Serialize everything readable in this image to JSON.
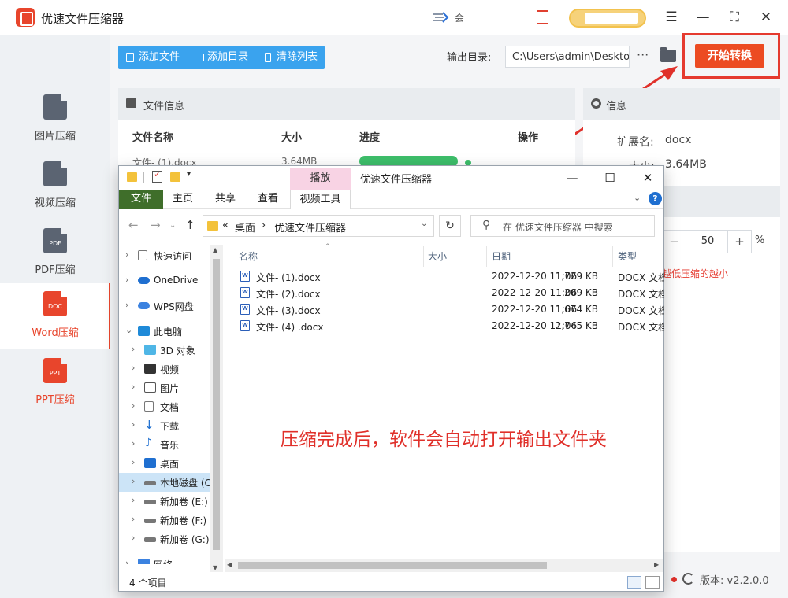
{
  "app": {
    "title": "优速文件压缩器",
    "titlebar_text": "会",
    "window_controls": [
      "☰",
      "—",
      "⛶",
      "✕"
    ]
  },
  "sidebar": {
    "items": [
      {
        "label": "图片压缩",
        "icon": "image-file-icon",
        "badge": ""
      },
      {
        "label": "视频压缩",
        "icon": "video-file-icon",
        "badge": ""
      },
      {
        "label": "PDF压缩",
        "icon": "pdf-file-icon",
        "badge": "PDF"
      },
      {
        "label": "Word压缩",
        "icon": "word-file-icon",
        "badge": "DOC",
        "active": true
      },
      {
        "label": "PPT压缩",
        "icon": "ppt-file-icon",
        "badge": "PPT"
      }
    ]
  },
  "toolbar": {
    "add_file": "添加文件",
    "add_dir": "添加目录",
    "clear_list": "清除列表",
    "output_label": "输出目录:",
    "output_path": "C:\\Users\\admin\\Deskto",
    "more": "···",
    "start": "开始转换"
  },
  "file_panel": {
    "title": "文件信息",
    "columns": [
      "文件名称",
      "大小",
      "进度",
      "操作"
    ],
    "partial_row": {
      "name": "文件- (1).docx",
      "size": "3.64MB",
      "progress": 1.0
    }
  },
  "info_panel": {
    "title": "信息",
    "ext_label": "扩展名:",
    "ext_value": "docx",
    "size_label": "大小:",
    "size_value": "3.64MB",
    "quality_value": "50",
    "quality_unit": "%",
    "hint": "越低压缩的越小"
  },
  "version": "版本: v2.2.0.0",
  "explorer": {
    "context_tab": "播放",
    "title": "优速文件压缩器",
    "ribbon_tabs": [
      "文件",
      "主页",
      "共享",
      "查看",
      "视频工具"
    ],
    "breadcrumb": [
      "«",
      "桌面",
      "›",
      "优速文件压缩器"
    ],
    "search_placeholder": "在 优速文件压缩器 中搜索",
    "nav_tree": [
      {
        "label": "快速访问",
        "icon": "star-icon",
        "level": 0,
        "expanded": false
      },
      {
        "label": "OneDrive",
        "icon": "cloud-icon",
        "level": 0,
        "expanded": false
      },
      {
        "label": "WPS网盘",
        "icon": "cloud-icon",
        "level": 0,
        "expanded": false
      },
      {
        "label": "此电脑",
        "icon": "computer-icon",
        "level": 0,
        "expanded": true
      },
      {
        "label": "3D 对象",
        "icon": "cube-icon",
        "level": 1
      },
      {
        "label": "视频",
        "icon": "film-icon",
        "level": 1
      },
      {
        "label": "图片",
        "icon": "picture-icon",
        "level": 1
      },
      {
        "label": "文档",
        "icon": "document-icon",
        "level": 1
      },
      {
        "label": "下载",
        "icon": "download-icon",
        "level": 1
      },
      {
        "label": "音乐",
        "icon": "music-icon",
        "level": 1
      },
      {
        "label": "桌面",
        "icon": "desktop-icon",
        "level": 1
      },
      {
        "label": "本地磁盘 (C",
        "icon": "drive-icon",
        "level": 1,
        "selected": true
      },
      {
        "label": "新加卷 (E:)",
        "icon": "drive-icon",
        "level": 1
      },
      {
        "label": "新加卷 (F:)",
        "icon": "drive-icon",
        "level": 1
      },
      {
        "label": "新加卷 (G:)",
        "icon": "drive-icon",
        "level": 1
      },
      {
        "label": "网络",
        "icon": "network-icon",
        "level": 0
      }
    ],
    "list_headers": [
      "名称",
      "大小",
      "日期",
      "类型"
    ],
    "files": [
      {
        "name": "文件- (1).docx",
        "size": "1,729 KB",
        "date": "2022-12-20 11:06",
        "type": "DOCX 文档"
      },
      {
        "name": "文件- (2).docx",
        "size": "209 KB",
        "date": "2022-12-20 11:06",
        "type": "DOCX 文档"
      },
      {
        "name": "文件- (3).docx",
        "size": "1,674 KB",
        "date": "2022-12-20 11:06",
        "type": "DOCX 文档"
      },
      {
        "name": "文件- (4) .docx",
        "size": "2,745 KB",
        "date": "2022-12-20 11:06",
        "type": "DOCX 文档"
      }
    ],
    "status_count": "4 个项目"
  },
  "annotation": "压缩完成后，软件会自动打开输出文件夹",
  "colors": {
    "accent": "#ec4b22",
    "toolbar_blue": "#3aa3ee",
    "progress_green": "#3dbe6a",
    "annotation_red": "#e0302a"
  }
}
